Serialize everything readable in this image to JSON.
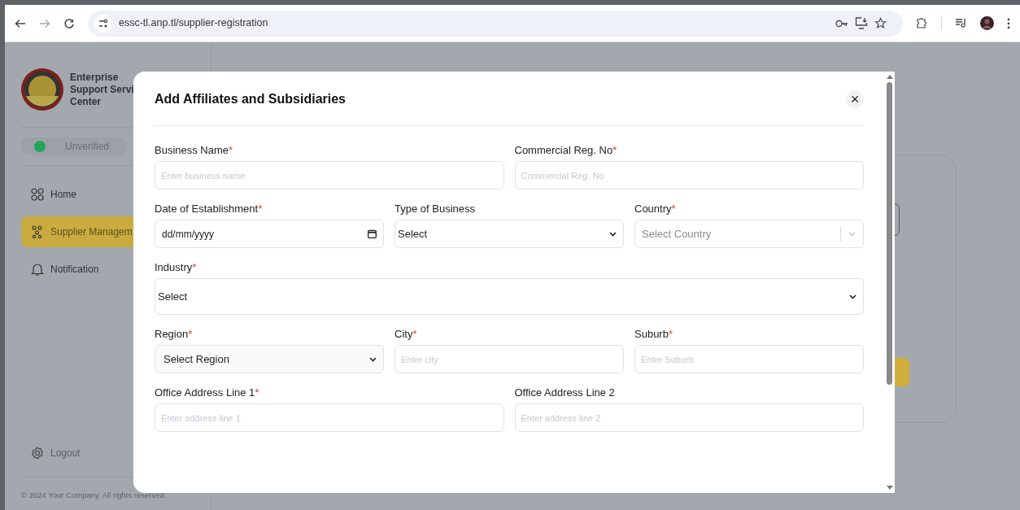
{
  "browser": {
    "url": "essc-tl.anp.tl/supplier-registration"
  },
  "sidebar": {
    "brand": [
      "Enterprise",
      "Support Servi",
      "Center"
    ],
    "status": {
      "label": "Unverified",
      "color": "#22a55a"
    },
    "items": [
      {
        "label": "Home",
        "kind": "grid",
        "selected": false
      },
      {
        "label": "Supplier Managem",
        "kind": "people",
        "selected": true
      },
      {
        "label": "Notification",
        "kind": "bell",
        "selected": false
      }
    ],
    "logout": "Logout",
    "footer": "© 2024 Your Company. All rights reserved."
  },
  "modal": {
    "title": "Add Affiliates and Subsidiaries",
    "close": "×",
    "rows": [
      [
        {
          "label": "Business Name",
          "required_mark": "*",
          "kind": "text",
          "placeholder": "Enter business name"
        },
        {
          "label": "Commercial Reg. No",
          "required_mark": "*",
          "kind": "text",
          "placeholder": "Commercial Reg. No"
        }
      ],
      [
        {
          "label": "Date of Establishment",
          "required_mark": "*",
          "kind": "date",
          "value": "dd/mm/yyyy"
        },
        {
          "label": "Type of Business",
          "kind": "select",
          "value": "Select"
        },
        {
          "label": "Country",
          "required_mark": "*",
          "kind": "combo",
          "placeholder": "Select Country"
        }
      ],
      [
        {
          "label": "Industry",
          "required_mark": "*",
          "kind": "select",
          "value": "Select"
        }
      ],
      [
        {
          "label": "Region",
          "required_mark": "*",
          "kind": "select",
          "value": "Select Region",
          "filled": true
        },
        {
          "label": "City",
          "required_mark": "*",
          "kind": "text",
          "placeholder": "Enter city"
        },
        {
          "label": "Suburb",
          "required_mark": "*",
          "kind": "text",
          "placeholder": "Enter Suburb"
        }
      ],
      [
        {
          "label": "Office Address Line 1",
          "required_mark": "*",
          "kind": "text",
          "placeholder": "Enter address line 1"
        },
        {
          "label": "Office Address Line 2",
          "kind": "text",
          "placeholder": "Enter address line 2"
        }
      ]
    ]
  }
}
